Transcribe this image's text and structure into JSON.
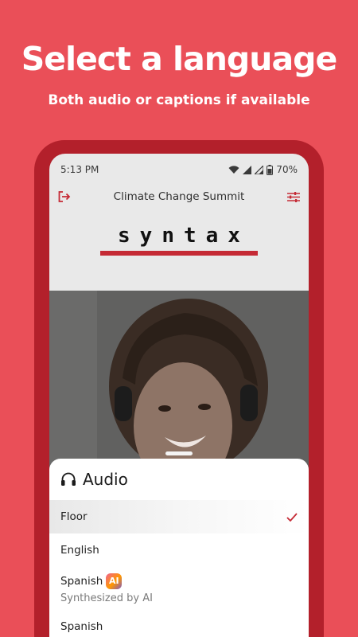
{
  "promo": {
    "headline": "Select a language",
    "subhead": "Both audio or captions if available",
    "colors": {
      "background": "#ea4f58",
      "frame": "#b3202b",
      "accent": "#c52a35"
    }
  },
  "status_bar": {
    "time": "5:13 PM",
    "battery": "70%",
    "icons": [
      "wifi-icon",
      "signal-icon",
      "signal-icon",
      "battery-icon"
    ]
  },
  "app_bar": {
    "title": "Climate Change Summit",
    "left_icon": "exit-icon",
    "right_icon": "settings-sliders-icon"
  },
  "logo": {
    "text": "syntax"
  },
  "audio_sheet": {
    "title": "Audio",
    "title_icon": "headphones-icon",
    "items": [
      {
        "label": "Floor",
        "selected": true,
        "check_icon": "checkmark-icon"
      },
      {
        "label": "English"
      },
      {
        "label": "Spanish",
        "badge": "AI",
        "sublabel": "Synthesized by AI"
      },
      {
        "label": "Spanish"
      }
    ]
  }
}
